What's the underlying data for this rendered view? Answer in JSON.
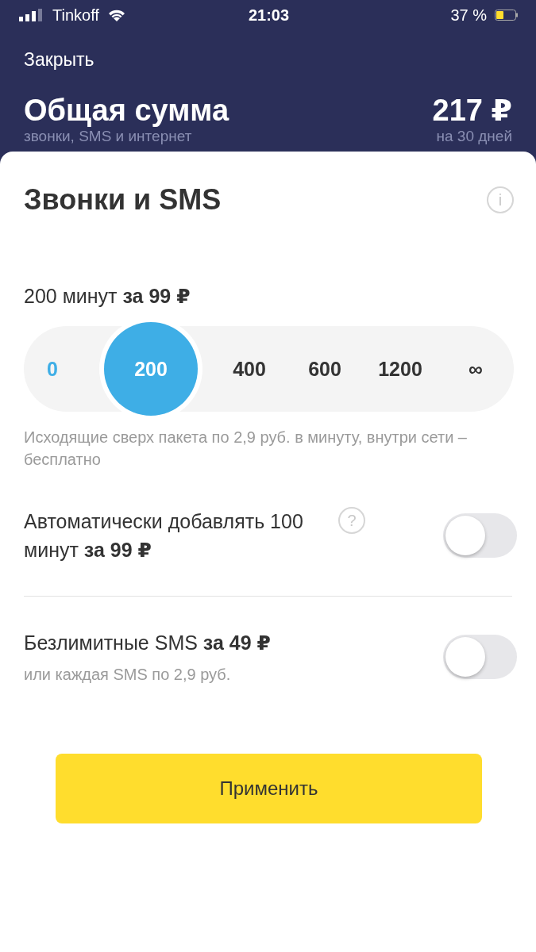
{
  "status_bar": {
    "carrier": "Tinkoff",
    "time": "21:03",
    "battery": "37 %"
  },
  "header": {
    "close": "Закрыть",
    "title": "Общая сумма",
    "subtitle": "звонки, SMS и интернет",
    "amount": "217 ₽",
    "period": "на 30 дней"
  },
  "section": {
    "title": "Звонки и SMS",
    "info_icon": "i"
  },
  "package": {
    "label": "200 минут **за 99 ₽**",
    "options": [
      {
        "label": "0",
        "selected": false
      },
      {
        "label": "200",
        "selected": true
      },
      {
        "label": "400",
        "selected": false
      },
      {
        "label": "600",
        "selected": false
      },
      {
        "label": "1200",
        "selected": false
      },
      {
        "label": "∞",
        "selected": false
      }
    ],
    "note": "Исходящие сверх пакета по 2,9 руб. в минуту, внутри сети – бесплатно"
  },
  "options": [
    {
      "label": "Автоматически добавлять 100 минут **за 99 ₽**",
      "help_icon": "?",
      "on": false
    },
    {
      "label": "Безлимитные SMS **за 49 ₽**",
      "note": "или каждая SMS по 2,9 руб.",
      "on": false
    }
  ],
  "apply_button": "Применить"
}
